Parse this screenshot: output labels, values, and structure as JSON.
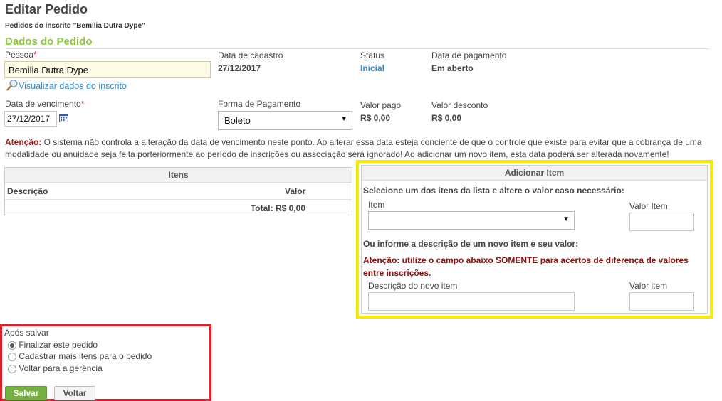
{
  "header": {
    "title": "Editar Pedido",
    "subtitle": "Pedidos do inscrito \"Bemilia Dutra Dype\""
  },
  "section": {
    "title": "Dados do Pedido"
  },
  "pessoa": {
    "label": "Pessoa",
    "required_mark": "*",
    "value": "Bemilia Dutra Dype",
    "view_link": "Visualizar dados do inscrito"
  },
  "data_cadastro": {
    "label": "Data de cadastro",
    "value": "27/12/2017"
  },
  "status": {
    "label": "Status",
    "value": "Inicial"
  },
  "data_pagamento": {
    "label": "Data de pagamento",
    "value": "Em aberto"
  },
  "vencimento": {
    "label": "Data de vencimento",
    "required_mark": "*",
    "value": "27/12/2017"
  },
  "forma_pagamento": {
    "label": "Forma de Pagamento",
    "selected": "Boleto"
  },
  "valor_pago": {
    "label": "Valor pago",
    "value": "R$ 0,00"
  },
  "valor_desconto": {
    "label": "Valor desconto",
    "value": "R$ 0,00"
  },
  "warning": {
    "prefix": "Atenção:",
    "text": " O sistema não controla a alteração da data de vencimento neste ponto. Ao alterar essa data esteja conciente de que o controle que existe para evitar que a cobrança de uma modalidade ou anuidade seja feita porteriormente ao período de inscrições ou associação será ignorado! Ao adicionar um novo item, esta data poderá ser alterada novamente!"
  },
  "items_table": {
    "title": "Itens",
    "col_descricao": "Descrição",
    "col_valor": "Valor",
    "total": "Total: R$ 0,00"
  },
  "add_item": {
    "title": "Adicionar Item",
    "instruction": "Selecione um dos itens da lista e altere o valor caso necessário:",
    "item_label": "Item",
    "item_selected": "",
    "valor_item_label": "Valor Item",
    "valor_item_value": "",
    "or_text": "Ou informe a descrição de um novo item e seu valor:",
    "warning": "Atenção: utilize o campo abaixo SOMENTE para acertos de diferença de valores entre inscrições.",
    "descricao_label": "Descrição do novo item",
    "descricao_value": "",
    "valor_item2_label": "Valor item",
    "valor_item2_value": ""
  },
  "after_save": {
    "label": "Após salvar",
    "options": [
      "Finalizar este pedido",
      "Cadastrar mais itens para o pedido",
      "Voltar para a gerência"
    ],
    "selected_index": 0
  },
  "buttons": {
    "save": "Salvar",
    "back": "Voltar"
  },
  "colors": {
    "accent_green": "#8dc63f",
    "link_blue": "#3a8ac4",
    "highlight_yellow": "#f5ea00",
    "highlight_red": "#e0202a"
  }
}
